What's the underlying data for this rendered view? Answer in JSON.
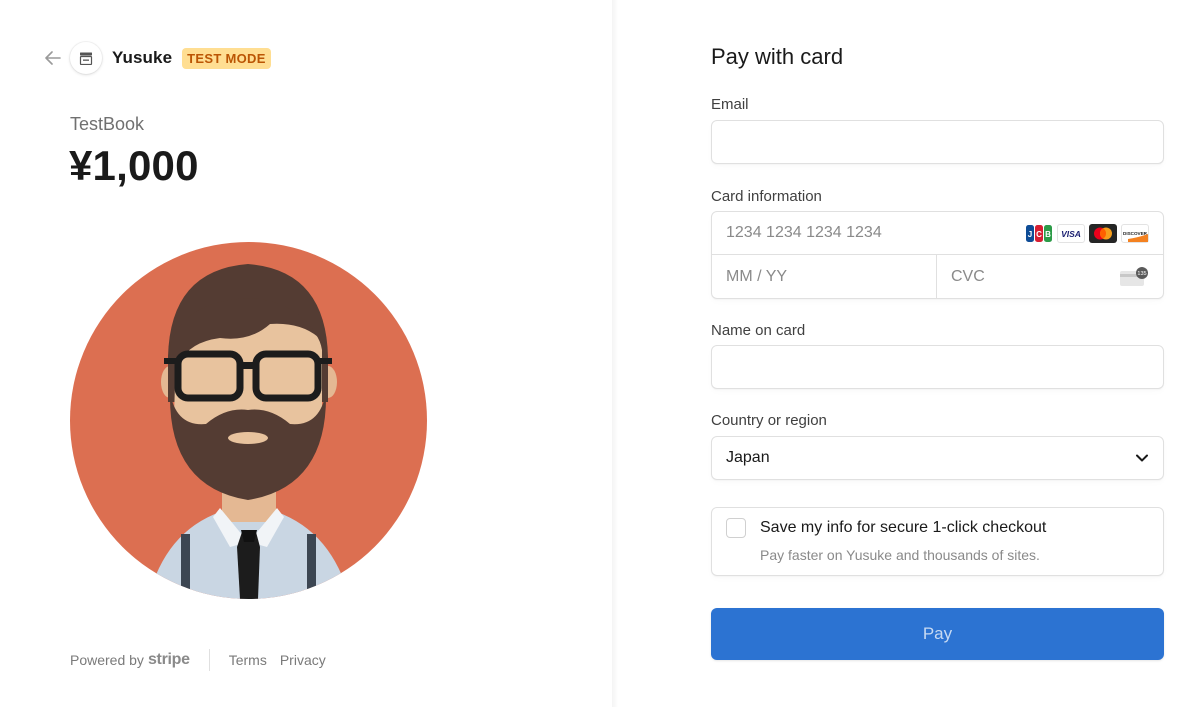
{
  "header": {
    "merchant_name": "Yusuke",
    "mode_badge": "TEST MODE"
  },
  "product": {
    "name": "TestBook",
    "price": "¥1,000"
  },
  "footer": {
    "powered_by": "Powered by",
    "powered_brand": "stripe",
    "links": [
      "Terms",
      "Privacy"
    ]
  },
  "form": {
    "title": "Pay with card",
    "email_label": "Email",
    "email_value": "",
    "card_label": "Card information",
    "card_number_placeholder": "1234 1234 1234 1234",
    "expiry_placeholder": "MM / YY",
    "cvc_placeholder": "CVC",
    "card_brands": [
      "JCB",
      "VISA",
      "Mastercard",
      "DISCOVER"
    ],
    "name_label": "Name on card",
    "name_value": "",
    "country_label": "Country or region",
    "country_value": "Japan",
    "save_title": "Save my info for secure 1-click checkout",
    "save_subtitle": "Pay faster on Yusuke and thousands of sites.",
    "save_checked": false,
    "pay_button": "Pay"
  },
  "colors": {
    "pay_button": "#2c73d2",
    "badge_bg": "#ffde92",
    "badge_text": "#bb5504",
    "avatar_bg": "#dc6f51"
  }
}
